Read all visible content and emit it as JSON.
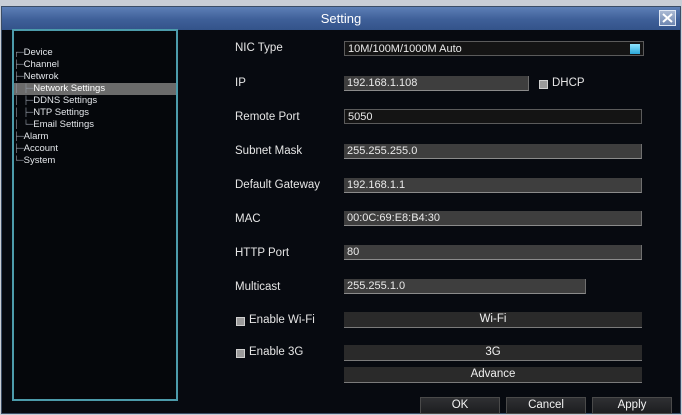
{
  "window": {
    "title": "Setting"
  },
  "tree": [
    {
      "prefix": "┌─",
      "label": "Device"
    },
    {
      "prefix": "├─",
      "label": "Channel"
    },
    {
      "prefix": "├─",
      "label": "Netwrok"
    },
    {
      "prefix": "│ ├─",
      "label": "Network Settings",
      "selected": true
    },
    {
      "prefix": "│ ├─",
      "label": "DDNS Settings"
    },
    {
      "prefix": "│ ├─",
      "label": "NTP Settings"
    },
    {
      "prefix": "│ └─",
      "label": "Email Settings"
    },
    {
      "prefix": "├─",
      "label": "Alarm"
    },
    {
      "prefix": "├─",
      "label": "Account"
    },
    {
      "prefix": "└─",
      "label": "System"
    }
  ],
  "form": {
    "nic_type": {
      "label": "NIC Type",
      "value": "10M/100M/1000M Auto"
    },
    "ip": {
      "label": "IP",
      "value": "192.168.1.108",
      "dhcp_label": "DHCP"
    },
    "remote_port": {
      "label": "Remote Port",
      "value": "5050"
    },
    "subnet_mask": {
      "label": "Subnet Mask",
      "value": "255.255.255.0"
    },
    "default_gateway": {
      "label": "Default Gateway",
      "value": "192.168.1.1"
    },
    "mac": {
      "label": "MAC",
      "value": "00:0C:69:E8:B4:30"
    },
    "http_port": {
      "label": "HTTP Port",
      "value": "80"
    },
    "multicast": {
      "label": "Multicast",
      "value": "255.255.1.0"
    },
    "wifi": {
      "checkbox_label": "Enable Wi-Fi",
      "button": "Wi-Fi"
    },
    "g3": {
      "checkbox_label": "Enable 3G",
      "button": "3G"
    },
    "advance_button": "Advance"
  },
  "footer": {
    "ok": "OK",
    "cancel": "Cancel",
    "apply": "Apply"
  },
  "icons": {
    "close": "close-icon",
    "dropdown": "chevron-down-icon"
  },
  "colors": {
    "titlebar": "#3e5f98",
    "tree_border": "#4c9bab",
    "background": "#070a10"
  }
}
